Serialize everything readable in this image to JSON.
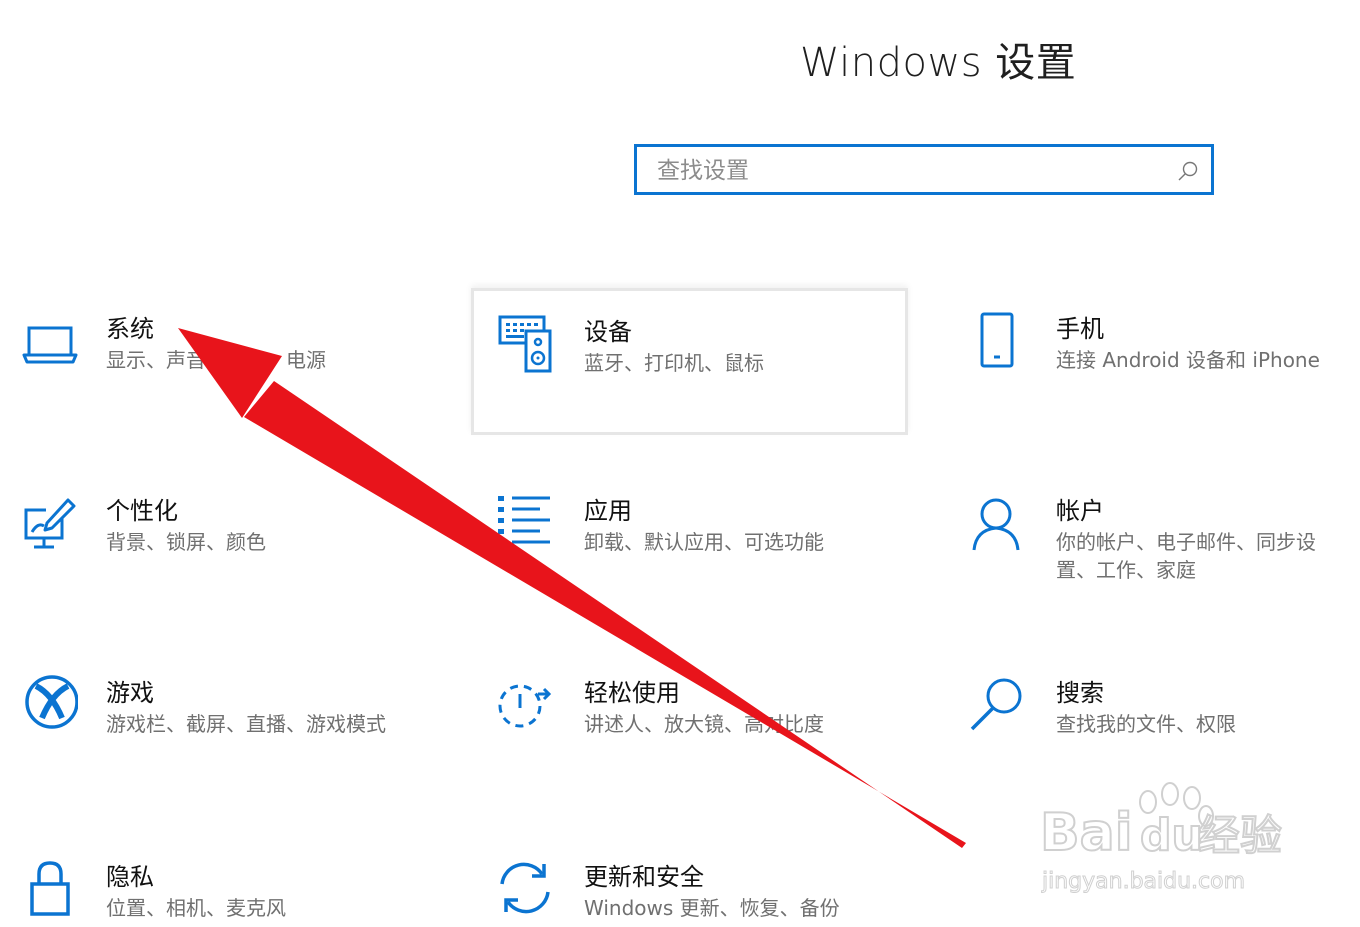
{
  "window": {
    "title": "Windows 设置"
  },
  "search": {
    "placeholder": "查找设置"
  },
  "tiles": [
    {
      "name": "系统",
      "desc": "显示、声音、通知、电源",
      "icon": "laptop-icon"
    },
    {
      "name": "设备",
      "desc": "蓝牙、打印机、鼠标",
      "icon": "devices-icon"
    },
    {
      "name": "手机",
      "desc": "连接 Android 设备和 iPhone",
      "icon": "phone-icon"
    },
    {
      "name": "个性化",
      "desc": "背景、锁屏、颜色",
      "icon": "personalization-icon"
    },
    {
      "name": "应用",
      "desc": "卸载、默认应用、可选功能",
      "icon": "apps-icon"
    },
    {
      "name": "帐户",
      "desc": "你的帐户、电子邮件、同步设置、工作、家庭",
      "icon": "account-icon"
    },
    {
      "name": "游戏",
      "desc": "游戏栏、截屏、直播、游戏模式",
      "icon": "xbox-icon"
    },
    {
      "name": "轻松使用",
      "desc": "讲述人、放大镜、高对比度",
      "icon": "ease-of-access-icon"
    },
    {
      "name": "搜索",
      "desc": "查找我的文件、权限",
      "icon": "search-icon"
    },
    {
      "name": "隐私",
      "desc": "位置、相机、麦克风",
      "icon": "lock-icon"
    },
    {
      "name": "更新和安全",
      "desc": "Windows 更新、恢复、备份",
      "icon": "update-sync-icon"
    }
  ],
  "watermark": {
    "brand": "Baidu经验",
    "url": "jingyan.baidu.com"
  },
  "colors": {
    "accent": "#0b74d1",
    "arrow": "#e8141b"
  }
}
